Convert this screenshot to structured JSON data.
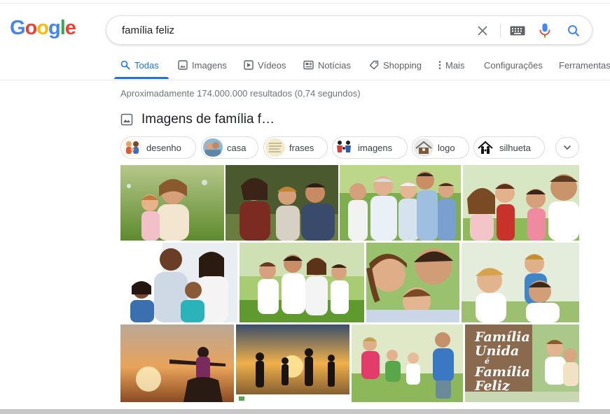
{
  "logo": {
    "letters": [
      "G",
      "o",
      "o",
      "g",
      "l",
      "e"
    ],
    "colors": [
      "#4285f4",
      "#ea4335",
      "#fbbc05",
      "#4285f4",
      "#34a853",
      "#ea4335"
    ]
  },
  "search": {
    "value": "família feliz",
    "clear_icon": "close-icon",
    "keyboard_icon": "keyboard-icon",
    "mic_icon": "microphone-icon",
    "search_icon": "search-icon"
  },
  "tabs": [
    {
      "label": "Todas",
      "icon": "search-icon",
      "active": true
    },
    {
      "label": "Imagens",
      "icon": "image-icon",
      "active": false
    },
    {
      "label": "Vídeos",
      "icon": "play-icon",
      "active": false
    },
    {
      "label": "Notícias",
      "icon": "newspaper-icon",
      "active": false
    },
    {
      "label": "Shopping",
      "icon": "tag-icon",
      "active": false
    },
    {
      "label": "Mais",
      "icon": "more-vert-icon",
      "active": false
    },
    {
      "label": "Configurações",
      "icon": "",
      "active": false
    },
    {
      "label": "Ferramentas",
      "icon": "",
      "active": false
    }
  ],
  "results_stats": "Aproximadamente 174.000.000 resultados (0,74 segundos)",
  "images_heading": "Imagens de família f…",
  "chips": [
    "desenho",
    "casa",
    "frases",
    "imagens",
    "logo",
    "silhueta"
  ],
  "tile_overlay": [
    "Família",
    "Unida",
    "é",
    "Família",
    "Feliz"
  ],
  "colors": {
    "accent": "#1a73e8",
    "muted": "#5f6368",
    "border": "#dadce0"
  }
}
